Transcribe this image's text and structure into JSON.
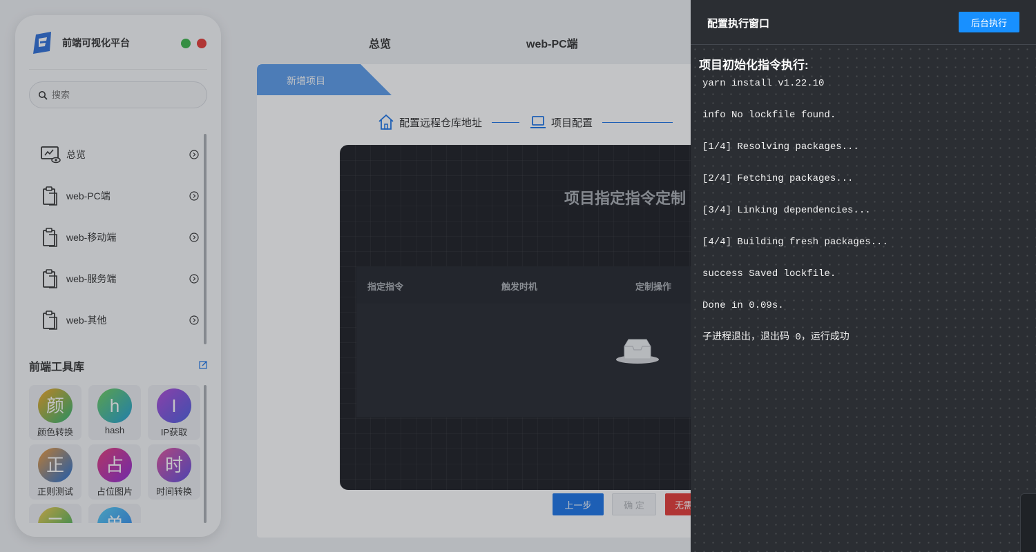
{
  "app": {
    "name": "前端可视化平台"
  },
  "search": {
    "placeholder": "搜索"
  },
  "sidebar": {
    "items": [
      {
        "label": "总览",
        "icon": "monitor-eye-icon"
      },
      {
        "label": "web-PC端",
        "icon": "clipboard-icon"
      },
      {
        "label": "web-移动端",
        "icon": "clipboard-icon"
      },
      {
        "label": "web-服务端",
        "icon": "clipboard-icon"
      },
      {
        "label": "web-其他",
        "icon": "clipboard-icon"
      }
    ],
    "tools_title": "前端工具库",
    "tools": [
      {
        "glyph": "颜",
        "label": "颜色转换",
        "color_a": "#f5a623",
        "color_b": "#2bb673"
      },
      {
        "glyph": "h",
        "label": "hash",
        "color_a": "#6fcf5a",
        "color_b": "#1f9fd8"
      },
      {
        "glyph": "I",
        "label": "IP获取",
        "color_a": "#b04ad8",
        "color_b": "#4a5ee0"
      },
      {
        "glyph": "正",
        "label": "正则测试",
        "color_a": "#f29b38",
        "color_b": "#1e6fd9"
      },
      {
        "glyph": "占",
        "label": "占位图片",
        "color_a": "#e63b7a",
        "color_b": "#8e2bd6"
      },
      {
        "glyph": "时",
        "label": "时间转换",
        "color_a": "#e2539c",
        "color_b": "#5d4de0"
      },
      {
        "glyph": "二",
        "label": "",
        "color_a": "#f2c94c",
        "color_b": "#27ae60"
      },
      {
        "glyph": "单",
        "label": "",
        "color_a": "#56ccf2",
        "color_b": "#2f80ed"
      }
    ]
  },
  "topnav": {
    "overview": "总览",
    "pc": "web-PC端"
  },
  "wizard": {
    "tab_label": "新增项目",
    "steps": [
      "配置远程仓库地址",
      "项目配置"
    ],
    "panel_title": "项目指定指令定制",
    "columns": [
      "指定指令",
      "触发时机",
      "定制操作"
    ],
    "buttons": {
      "prev": "上一步",
      "ok": "确 定",
      "none": "无需"
    }
  },
  "drawer": {
    "title": "配置执行窗口",
    "bg_button": "后台执行",
    "log_title": "项目初始化指令执行:",
    "log_lines": [
      "yarn install v1.22.10",
      "info No lockfile found.",
      "[1/4] Resolving packages...",
      "[2/4] Fetching packages...",
      "[3/4] Linking dependencies...",
      "[4/4] Building fresh packages...",
      "success Saved lockfile.",
      "Done in 0.09s.",
      "子进程退出，退出码 0，运行成功"
    ]
  }
}
